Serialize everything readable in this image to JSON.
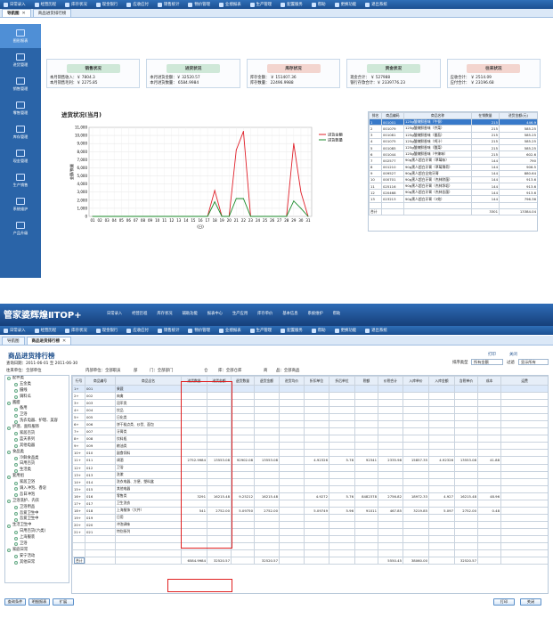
{
  "top_menu": [
    "日常录入",
    "经营历程",
    "库存状况",
    "现金银行",
    "应收应付",
    "销售统计",
    "物价管理",
    "业绩报表",
    "生产管理",
    "配置服务",
    "帮助",
    "更换功能",
    "退出系统"
  ],
  "tabs1": [
    "导航图",
    "商品进货排行榜"
  ],
  "sidebar": [
    "图形报表",
    "进货管理",
    "销售管理",
    "零售管理",
    "库存管理",
    "现金管理",
    "生产销售",
    "系统维护",
    "产品升级"
  ],
  "cards": [
    {
      "title": "销售状况",
      "color": "#cfe8d8",
      "lines": [
        "本月销售收入：￥ 7804.3",
        "本月销售毛利：￥ 2275.85"
      ]
    },
    {
      "title": "进货状况",
      "color": "#cfe8d8",
      "lines": [
        "本月进货金额：￥ 32520.57",
        "本月进货数量： 6584.9984"
      ]
    },
    {
      "title": "库存状况",
      "color": "#f3d5cf",
      "lines": [
        "库存金额：  ￥ 151407.36",
        "库存数量：  22496.9988"
      ]
    },
    {
      "title": "资金状况",
      "color": "#cfe8d8",
      "lines": [
        "现金合计：  ￥ 527988",
        "银行存款合计：￥ 2339776.23"
      ]
    },
    {
      "title": "往来状况",
      "color": "#f3d5cf",
      "lines": [
        "应收合计：  ￥ 2514.09",
        "应付合计：  ￥ 23196.68"
      ]
    }
  ],
  "chart_data": {
    "type": "line",
    "title": "进货状况(当月)",
    "ylabel": "金额/数量",
    "xlabel": "(日)",
    "categories": [
      "01",
      "02",
      "03",
      "04",
      "05",
      "06",
      "07",
      "08",
      "09",
      "10",
      "11",
      "12",
      "13",
      "14",
      "15",
      "16",
      "17",
      "18",
      "19",
      "20",
      "21",
      "22",
      "23",
      "24",
      "25",
      "26",
      "27",
      "28",
      "29",
      "30",
      "31"
    ],
    "ylim": [
      0,
      11000
    ],
    "yticks": [
      "0",
      "1,000",
      "2,000",
      "3,000",
      "4,000",
      "5,000",
      "6,000",
      "7,000",
      "8,000",
      "9,000",
      "10,000",
      "11,000"
    ],
    "series": [
      {
        "name": "进货金额",
        "color": "#e0202a",
        "values": [
          0,
          0,
          0,
          0,
          0,
          0,
          0,
          0,
          0,
          0,
          0,
          0,
          0,
          0,
          0,
          0,
          0,
          3200,
          0,
          0,
          8200,
          10500,
          0,
          0,
          0,
          0,
          0,
          0,
          9000,
          3000,
          0
        ]
      },
      {
        "name": "进货数量",
        "color": "#1a8a2a",
        "values": [
          0,
          0,
          0,
          0,
          0,
          0,
          0,
          0,
          0,
          0,
          0,
          0,
          0,
          0,
          0,
          0,
          0,
          1800,
          0,
          0,
          2200,
          2200,
          0,
          0,
          0,
          0,
          0,
          0,
          1900,
          1000,
          0
        ]
      }
    ]
  },
  "rank1": {
    "headers": [
      "排名",
      "商品编码",
      "商品名称",
      "在销数量",
      "进货金额(元)"
    ],
    "rows": [
      [
        "1",
        "001001",
        "125g酸辣鲜香味（午餐）",
        "215",
        "446.9"
      ],
      [
        "2",
        "001079",
        "125g酸辣鲜香味（芥菜）",
        "215",
        "585.25"
      ],
      [
        "3",
        "001081",
        "125g酸辣鲜香味（番茄）",
        "215",
        "585.25"
      ],
      [
        "4",
        "001075",
        "125g酸辣鲜香味（鸡汁）",
        "215",
        "585.25"
      ],
      [
        "5",
        "001085",
        "125g酸辣鲜香味（酸菜）",
        "215",
        "585.25"
      ],
      [
        "6",
        "001044",
        "125g酸辣鲜香味（中辣味）",
        "215",
        "602.6"
      ],
      [
        "7",
        "002577",
        "90g黑人超白牙膏（草莓味）",
        "144",
        "790"
      ],
      [
        "8",
        "001210",
        "90g黑人超白牙膏（草莓薄荷）",
        "144",
        "906.5"
      ],
      [
        "9",
        "009527",
        "90g黑人超白全效牙膏",
        "144",
        "880.64"
      ],
      [
        "10",
        "000701",
        "90g黑人超白牙膏（杰林除菌）",
        "144",
        "913.6"
      ],
      [
        "11",
        "025116",
        "90g黑人超白牙膏（杰林净垢）",
        "144",
        "913.6"
      ],
      [
        "12",
        "020468",
        "90g黑人超白牙膏（杰林含菌）",
        "144",
        "913.6"
      ],
      [
        "13",
        "023213",
        "90g黑人超白牙膏（3效）",
        "144",
        "796.36"
      ]
    ],
    "total_label": "合计",
    "total_qty": "3301",
    "total_amt": "13384.04"
  },
  "app2": {
    "logo": "管家婆辉煌ⅡTOP+",
    "menu": [
      "日常录入",
      "经营历程",
      "库存状况",
      "辅助功能",
      "报表中心",
      "生产应用",
      "库存单价",
      "基本信息",
      "系统维护",
      "帮助"
    ]
  },
  "tabs2": [
    "导航图",
    "商品进货排行榜"
  ],
  "report": {
    "title": "商品进货排行榜",
    "period": "查询日期：2011-06-01 至 2011-06-30",
    "branch": "往来单位：全部单位",
    "dept_label": "部",
    "dept_val": "门：全部部门",
    "store_label": "仓",
    "store_val": "库：全部仓库",
    "goods_label": "商",
    "goods_val": "品：全部商品",
    "op": "内部单位：全部职员",
    "sort_label": "排序类型",
    "sort_val": "所有金额",
    "filter_label": "过滤",
    "filter_val": "显示所有",
    "print": "打印",
    "close_label": "关闭"
  },
  "tree": [
    "配件类",
    "五金类",
    "摄线",
    "调料瓜",
    "酱腊",
    "备用",
    "卫浴",
    "洗衣电器、护理、美容",
    "护理、面料服饰",
    "家居百货",
    "蓝天系列",
    "其他电器",
    "食品类",
    "冷鲜食品类",
    "日用百货",
    "生活类",
    "套用组",
    "家居卫浴",
    "调入冲泡、香皂",
    "吾日冲泡",
    "卫浴洗护、内衣",
    "卫浴用品",
    "吾爱卫生中",
    "吾爱卫生中",
    "生活卫生中",
    "日用百货(六类)",
    "上海服装",
    "卫浴",
    "家庭日常",
    "安宁活动",
    "其他日常"
  ],
  "table2": {
    "headers": [
      "行号",
      "商品编号",
      "商品全名",
      "进货数量",
      "进货金额",
      "退货数量",
      "退货金额",
      "进货均价",
      "折扣单位",
      "折后单位",
      "税额",
      "价税合计",
      "入库单价",
      "入库金额",
      "含税单价",
      "成本",
      "运费"
    ],
    "rows": [
      [
        "1+",
        "001",
        "果蔬",
        "",
        "",
        "",
        "",
        "",
        "",
        "",
        "",
        "",
        "",
        "",
        "",
        "",
        ""
      ],
      [
        "2+",
        "002",
        "肉禽",
        "",
        "",
        "",
        "",
        "",
        "",
        "",
        "",
        "",
        "",
        "",
        "",
        "",
        ""
      ],
      [
        "3+",
        "003",
        "冠军类",
        "",
        "",
        "",
        "",
        "",
        "",
        "",
        "",
        "",
        "",
        "",
        "",
        "",
        ""
      ],
      [
        "4+",
        "004",
        "饮品",
        "",
        "",
        "",
        "",
        "",
        "",
        "",
        "",
        "",
        "",
        "",
        "",
        "",
        ""
      ],
      [
        "5+",
        "005",
        "日化类",
        "",
        "",
        "",
        "",
        "",
        "",
        "",
        "",
        "",
        "",
        "",
        "",
        "",
        ""
      ],
      [
        "6+",
        "006",
        "饼干糕点类、炒货、面包",
        "",
        "",
        "",
        "",
        "",
        "",
        "",
        "",
        "",
        "",
        "",
        "",
        "",
        ""
      ],
      [
        "7+",
        "007",
        "牙膏类",
        "",
        "",
        "",
        "",
        "",
        "",
        "",
        "",
        "",
        "",
        "",
        "",
        "",
        ""
      ],
      [
        "8+",
        "008",
        "饮料瓶",
        "",
        "",
        "",
        "",
        "",
        "",
        "",
        "",
        "",
        "",
        "",
        "",
        "",
        ""
      ],
      [
        "9+",
        "009",
        "粮油类",
        "",
        "",
        "",
        "",
        "",
        "",
        "",
        "",
        "",
        "",
        "",
        "",
        "",
        ""
      ],
      [
        "10+",
        "010",
        "副食饲料",
        "",
        "",
        "",
        "",
        "",
        "",
        "",
        "",
        "",
        "",
        "",
        "",
        "",
        ""
      ],
      [
        "11+",
        "011",
        "调酒",
        "2752.9984",
        "13553.08",
        "92902.08",
        "13553.08",
        "",
        "4.92326",
        "5.78",
        "92341",
        "2335.98",
        "15857.35",
        "4.92326",
        "13553.08",
        "41.88",
        ""
      ],
      [
        "12+",
        "012",
        "卫浴",
        "",
        "",
        "",
        "",
        "",
        "",
        "",
        "",
        "",
        "",
        "",
        "",
        "",
        ""
      ],
      [
        "13+",
        "013",
        "洗漱",
        "",
        "",
        "",
        "",
        "",
        "",
        "",
        "",
        "",
        "",
        "",
        "",
        "",
        ""
      ],
      [
        "14+",
        "014",
        "洗衣电器、方便、塑料盒",
        "",
        "",
        "",
        "",
        "",
        "",
        "",
        "",
        "",
        "",
        "",
        "",
        "",
        ""
      ],
      [
        "15+",
        "015",
        "其他电器",
        "",
        "",
        "",
        "",
        "",
        "",
        "",
        "",
        "",
        "",
        "",
        "",
        "",
        ""
      ],
      [
        "16+",
        "016",
        "零售类",
        "3291",
        "16215.48",
        "9.25212",
        "16215.48",
        "",
        "4.9272",
        "5.76",
        "8482378",
        "2756.82",
        "18972.33",
        "4.927",
        "16215.48",
        "48.96",
        ""
      ],
      [
        "17+",
        "017",
        "卫生洗衣",
        "",
        "",
        "",
        "",
        "",
        "",
        "",
        "",
        "",
        "",
        "",
        "",
        "",
        ""
      ],
      [
        "18+",
        "018",
        "上海服饰（大件）",
        "541",
        "2752.00",
        "5.09750",
        "2752.00",
        "",
        "5.09749",
        "5.96",
        "91011",
        "467.85",
        "3219.85",
        "5.097",
        "2752.00",
        "0.48",
        ""
      ],
      [
        "19+",
        "019",
        "日用",
        "",
        "",
        "",
        "",
        "",
        "",
        "",
        "",
        "",
        "",
        "",
        "",
        "",
        ""
      ],
      [
        "20+",
        "020",
        "冲泡调味",
        "",
        "",
        "",
        "",
        "",
        "",
        "",
        "",
        "",
        "",
        "",
        "",
        "",
        ""
      ],
      [
        "21+",
        "021",
        "特别系列",
        "",
        "",
        "",
        "",
        "",
        "",
        "",
        "",
        "",
        "",
        "",
        "",
        "",
        ""
      ]
    ],
    "total_label": "合计",
    "total_vals": [
      "6584.9984",
      "32520.57",
      "",
      "32520.57",
      "",
      "",
      "",
      "",
      "5550.45",
      "38060.00",
      "",
      "32520.57",
      "",
      ""
    ]
  },
  "bottom_buttons": [
    "查询条件",
    "明细报表",
    "扩展"
  ],
  "bottom_right": [
    "打印",
    "关闭"
  ]
}
